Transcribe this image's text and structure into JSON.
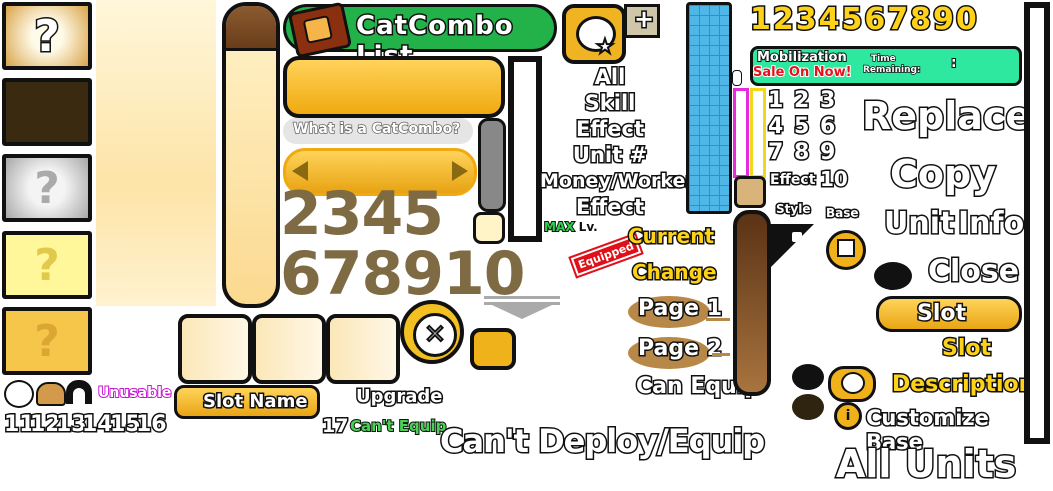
{
  "header": {
    "title": "CatCombo List",
    "what_is": "What is a CatCombo?"
  },
  "big_digits": {
    "row1": "2345",
    "row2": "678910"
  },
  "top_digits": "1234567890",
  "categories": [
    "All",
    "Skill",
    "Effect",
    "Unit #",
    "Money/Worker",
    "Effect"
  ],
  "max_level": {
    "max": "MAX",
    "lv": "Lv."
  },
  "equipped_stamp": "Equipped",
  "labels": {
    "current": "Current",
    "change": "Change",
    "page1": "Page 1",
    "page2": "Page 2",
    "can_equip": "Can Equip",
    "cant_deploy": "Can't Deploy/Equip",
    "upgrade": "Upgrade",
    "cant_equip": "Can't Equip",
    "unusable": "Unusable",
    "slot_name": "Slot Name",
    "style": "Style",
    "base": "Base",
    "effect": "Effect"
  },
  "mobilization": {
    "title": "Mobilization",
    "sale": "Sale On Now!",
    "time": "Time",
    "remaining": "Remaining:",
    "colon": ":"
  },
  "grid_numbers": [
    "1",
    "2",
    "3",
    "4",
    "5",
    "6",
    "7",
    "8",
    "9"
  ],
  "effect_ten": "10",
  "right_labels": {
    "replace": "Replace",
    "copy": "Copy",
    "unit": "Unit",
    "info": "Info",
    "close": "Close",
    "slot_btn": "Slot",
    "slot": "Slot",
    "description": "Description",
    "customize_base": "Customize Base",
    "all_units": "All Units"
  },
  "small_numbers": [
    "11",
    "12",
    "13",
    "14",
    "15",
    "16",
    "17"
  ],
  "question_mark": "?",
  "plus": "+",
  "close_x": "✕",
  "info_i": "i"
}
